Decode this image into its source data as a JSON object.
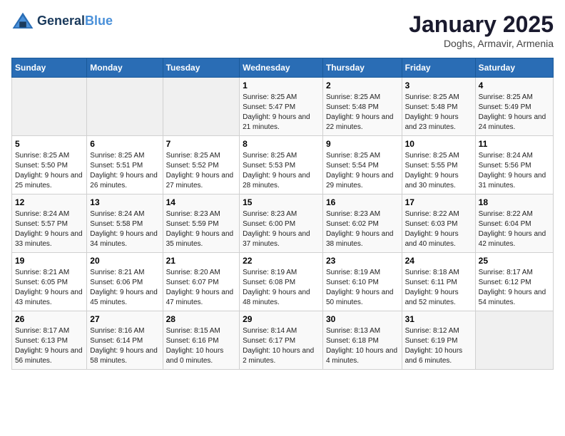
{
  "logo": {
    "line1": "General",
    "line2": "Blue"
  },
  "title": "January 2025",
  "subtitle": "Doghs, Armavir, Armenia",
  "days_header": [
    "Sunday",
    "Monday",
    "Tuesday",
    "Wednesday",
    "Thursday",
    "Friday",
    "Saturday"
  ],
  "weeks": [
    [
      {
        "day": "",
        "info": ""
      },
      {
        "day": "",
        "info": ""
      },
      {
        "day": "",
        "info": ""
      },
      {
        "day": "1",
        "sunrise": "8:25 AM",
        "sunset": "5:47 PM",
        "daylight": "9 hours and 21 minutes."
      },
      {
        "day": "2",
        "sunrise": "8:25 AM",
        "sunset": "5:48 PM",
        "daylight": "9 hours and 22 minutes."
      },
      {
        "day": "3",
        "sunrise": "8:25 AM",
        "sunset": "5:48 PM",
        "daylight": "9 hours and 23 minutes."
      },
      {
        "day": "4",
        "sunrise": "8:25 AM",
        "sunset": "5:49 PM",
        "daylight": "9 hours and 24 minutes."
      }
    ],
    [
      {
        "day": "5",
        "sunrise": "8:25 AM",
        "sunset": "5:50 PM",
        "daylight": "9 hours and 25 minutes."
      },
      {
        "day": "6",
        "sunrise": "8:25 AM",
        "sunset": "5:51 PM",
        "daylight": "9 hours and 26 minutes."
      },
      {
        "day": "7",
        "sunrise": "8:25 AM",
        "sunset": "5:52 PM",
        "daylight": "9 hours and 27 minutes."
      },
      {
        "day": "8",
        "sunrise": "8:25 AM",
        "sunset": "5:53 PM",
        "daylight": "9 hours and 28 minutes."
      },
      {
        "day": "9",
        "sunrise": "8:25 AM",
        "sunset": "5:54 PM",
        "daylight": "9 hours and 29 minutes."
      },
      {
        "day": "10",
        "sunrise": "8:25 AM",
        "sunset": "5:55 PM",
        "daylight": "9 hours and 30 minutes."
      },
      {
        "day": "11",
        "sunrise": "8:24 AM",
        "sunset": "5:56 PM",
        "daylight": "9 hours and 31 minutes."
      }
    ],
    [
      {
        "day": "12",
        "sunrise": "8:24 AM",
        "sunset": "5:57 PM",
        "daylight": "9 hours and 33 minutes."
      },
      {
        "day": "13",
        "sunrise": "8:24 AM",
        "sunset": "5:58 PM",
        "daylight": "9 hours and 34 minutes."
      },
      {
        "day": "14",
        "sunrise": "8:23 AM",
        "sunset": "5:59 PM",
        "daylight": "9 hours and 35 minutes."
      },
      {
        "day": "15",
        "sunrise": "8:23 AM",
        "sunset": "6:00 PM",
        "daylight": "9 hours and 37 minutes."
      },
      {
        "day": "16",
        "sunrise": "8:23 AM",
        "sunset": "6:02 PM",
        "daylight": "9 hours and 38 minutes."
      },
      {
        "day": "17",
        "sunrise": "8:22 AM",
        "sunset": "6:03 PM",
        "daylight": "9 hours and 40 minutes."
      },
      {
        "day": "18",
        "sunrise": "8:22 AM",
        "sunset": "6:04 PM",
        "daylight": "9 hours and 42 minutes."
      }
    ],
    [
      {
        "day": "19",
        "sunrise": "8:21 AM",
        "sunset": "6:05 PM",
        "daylight": "9 hours and 43 minutes."
      },
      {
        "day": "20",
        "sunrise": "8:21 AM",
        "sunset": "6:06 PM",
        "daylight": "9 hours and 45 minutes."
      },
      {
        "day": "21",
        "sunrise": "8:20 AM",
        "sunset": "6:07 PM",
        "daylight": "9 hours and 47 minutes."
      },
      {
        "day": "22",
        "sunrise": "8:19 AM",
        "sunset": "6:08 PM",
        "daylight": "9 hours and 48 minutes."
      },
      {
        "day": "23",
        "sunrise": "8:19 AM",
        "sunset": "6:10 PM",
        "daylight": "9 hours and 50 minutes."
      },
      {
        "day": "24",
        "sunrise": "8:18 AM",
        "sunset": "6:11 PM",
        "daylight": "9 hours and 52 minutes."
      },
      {
        "day": "25",
        "sunrise": "8:17 AM",
        "sunset": "6:12 PM",
        "daylight": "9 hours and 54 minutes."
      }
    ],
    [
      {
        "day": "26",
        "sunrise": "8:17 AM",
        "sunset": "6:13 PM",
        "daylight": "9 hours and 56 minutes."
      },
      {
        "day": "27",
        "sunrise": "8:16 AM",
        "sunset": "6:14 PM",
        "daylight": "9 hours and 58 minutes."
      },
      {
        "day": "28",
        "sunrise": "8:15 AM",
        "sunset": "6:16 PM",
        "daylight": "10 hours and 0 minutes."
      },
      {
        "day": "29",
        "sunrise": "8:14 AM",
        "sunset": "6:17 PM",
        "daylight": "10 hours and 2 minutes."
      },
      {
        "day": "30",
        "sunrise": "8:13 AM",
        "sunset": "6:18 PM",
        "daylight": "10 hours and 4 minutes."
      },
      {
        "day": "31",
        "sunrise": "8:12 AM",
        "sunset": "6:19 PM",
        "daylight": "10 hours and 6 minutes."
      },
      {
        "day": "",
        "info": ""
      }
    ]
  ],
  "labels": {
    "sunrise": "Sunrise:",
    "sunset": "Sunset:",
    "daylight": "Daylight:"
  }
}
